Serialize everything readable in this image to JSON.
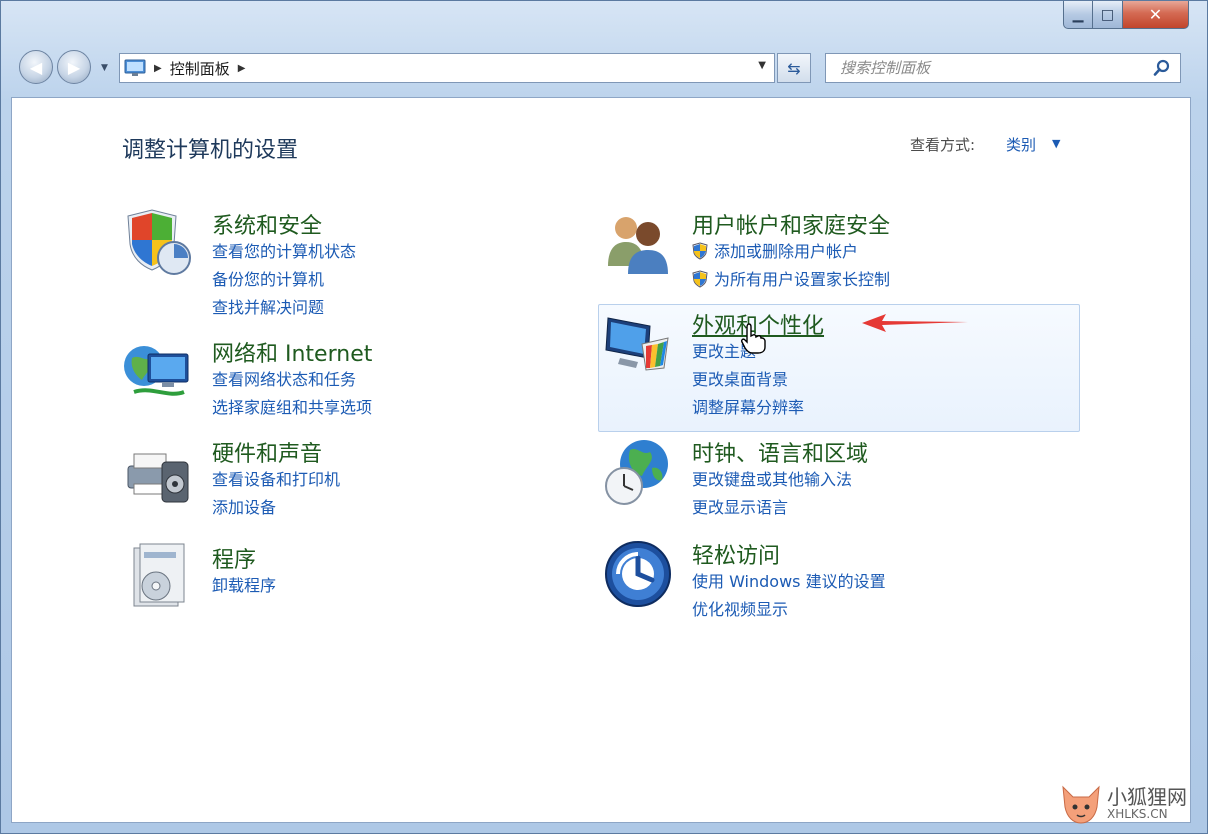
{
  "window": {
    "minimize": "▁",
    "maximize": "□",
    "close": "✕"
  },
  "nav": {
    "back_icon": "back-arrow-icon",
    "forward_icon": "forward-arrow-icon",
    "breadcrumb": "控制面板",
    "refresh_icon": "refresh-icon",
    "search_placeholder": "搜索控制面板"
  },
  "header": {
    "title": "调整计算机的设置",
    "view_label": "查看方式:",
    "view_value": "类别"
  },
  "categories": {
    "system": {
      "title": "系统和安全",
      "links": [
        "查看您的计算机状态",
        "备份您的计算机",
        "查找并解决问题"
      ]
    },
    "network": {
      "title": "网络和 Internet",
      "links": [
        "查看网络状态和任务",
        "选择家庭组和共享选项"
      ]
    },
    "hardware": {
      "title": "硬件和声音",
      "links": [
        "查看设备和打印机",
        "添加设备"
      ]
    },
    "programs": {
      "title": "程序",
      "links": [
        "卸载程序"
      ]
    },
    "users": {
      "title": "用户帐户和家庭安全",
      "links": [
        "添加或删除用户帐户",
        "为所有用户设置家长控制"
      ]
    },
    "appearance": {
      "title": "外观和个性化",
      "links": [
        "更改主题",
        "更改桌面背景",
        "调整屏幕分辨率"
      ]
    },
    "clock": {
      "title": "时钟、语言和区域",
      "links": [
        "更改键盘或其他输入法",
        "更改显示语言"
      ]
    },
    "ease": {
      "title": "轻松访问",
      "links": [
        "使用 Windows 建议的设置",
        "优化视频显示"
      ]
    }
  },
  "watermark": {
    "line1": "小狐狸网",
    "line2": "XHLKS.CN"
  },
  "colors": {
    "link": "#1c5bb4",
    "category_title": "#1f5a1f",
    "annotation_arrow": "#e53935"
  }
}
